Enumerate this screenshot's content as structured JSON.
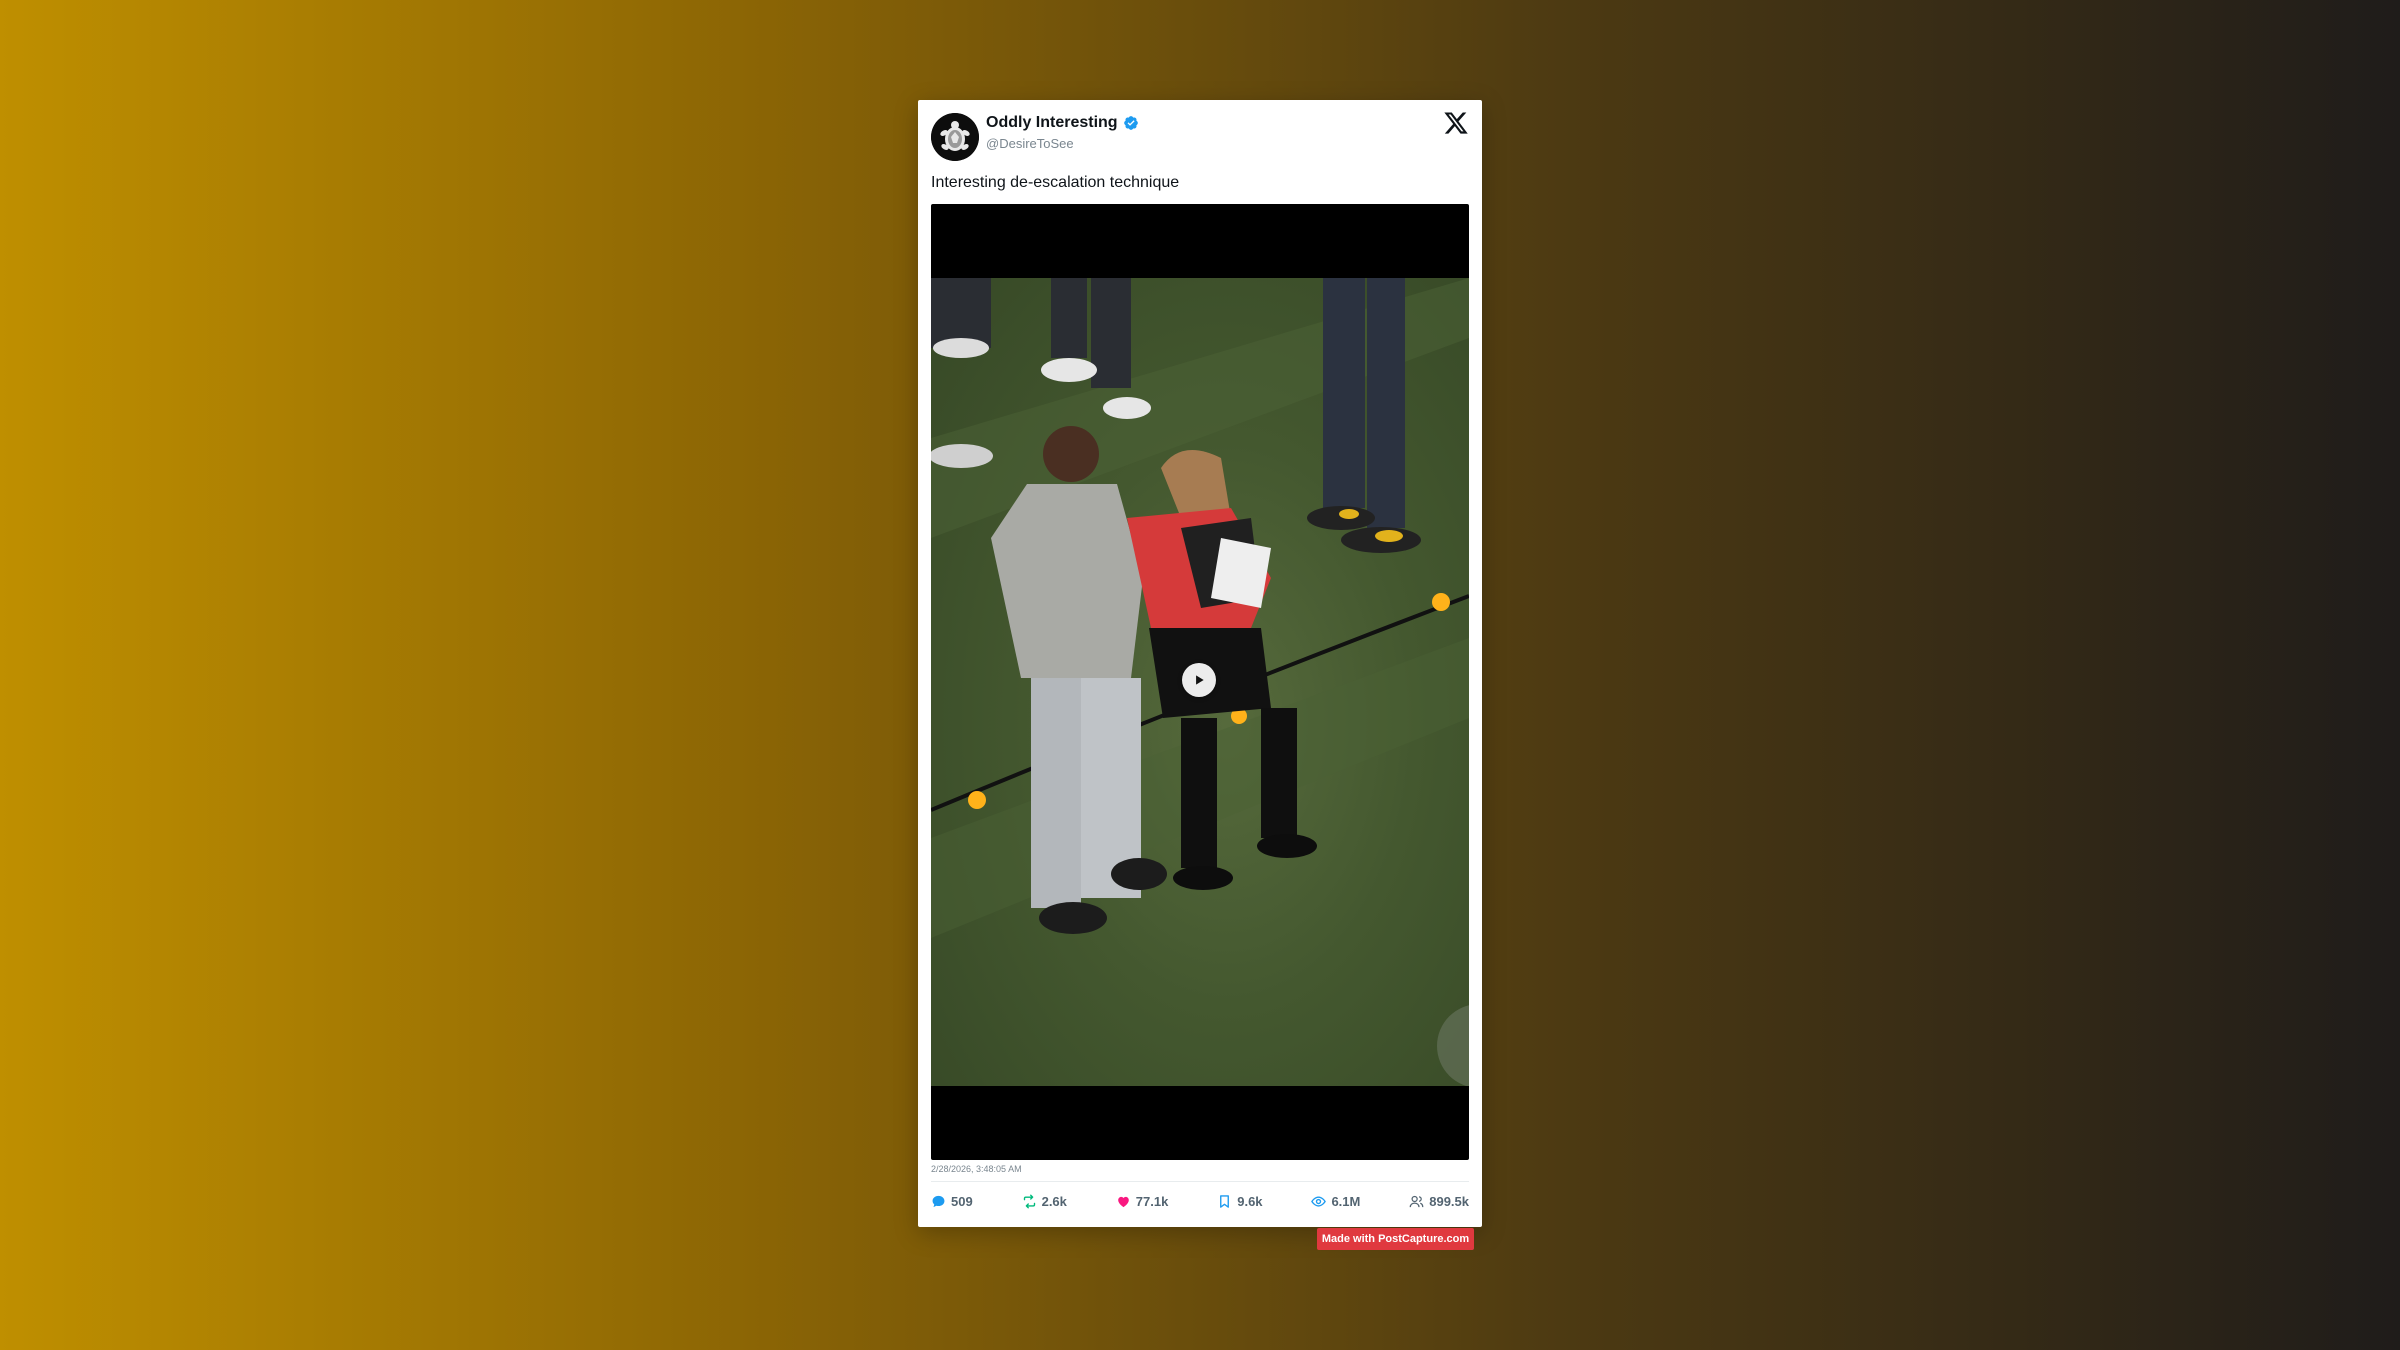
{
  "author": {
    "display_name": "Oddly Interesting",
    "handle": "@DesireToSee",
    "verified": true,
    "verified_icon": "verified-badge-icon",
    "avatar_icon": "turtle-avatar"
  },
  "platform_icon": "x-logo-icon",
  "tweet": {
    "text": "Interesting de-escalation technique",
    "media": {
      "type": "video",
      "play_icon": "play-icon",
      "description_visible": "video still of two people on a grass field"
    },
    "timestamp": "2/28/2026, 3:48:05 AM"
  },
  "stats": [
    {
      "icon": "reply-icon",
      "value": "509",
      "color": "#1d9bf0"
    },
    {
      "icon": "retweet-icon",
      "value": "2.6k",
      "color": "#00ba7c"
    },
    {
      "icon": "heart-icon",
      "value": "77.1k",
      "color": "#f91880"
    },
    {
      "icon": "bookmark-icon",
      "value": "9.6k",
      "color": "#1d9bf0"
    },
    {
      "icon": "views-icon",
      "value": "6.1M",
      "color": "#1d9bf0"
    },
    {
      "icon": "followers-icon",
      "value": "899.5k",
      "color": "#536471"
    }
  ],
  "watermark": "Made with PostCapture.com",
  "colors": {
    "accent_blue": "#1d9bf0",
    "badge_red": "#e0393f",
    "background_left": "#bf8f00",
    "background_right": "#1f1c1a"
  }
}
